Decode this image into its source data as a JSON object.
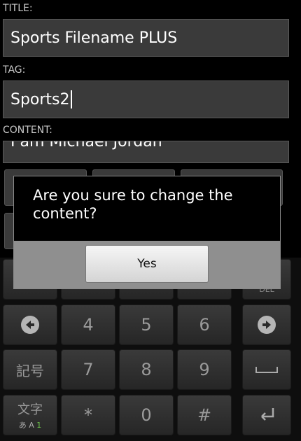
{
  "form": {
    "title_label": "TITLE:",
    "title_value": "Sports Filename PLUS",
    "tag_label": "TAG:",
    "tag_value": "Sports2",
    "content_label": "CONTENT:",
    "content_value": "I am Michael Jordan"
  },
  "dialog": {
    "message": "Are you sure to change the content?",
    "yes_label": "Yes"
  },
  "keyboard": {
    "row_digits_1": [
      "4",
      "5",
      "6"
    ],
    "row_digits_2": [
      "7",
      "8",
      "9"
    ],
    "row_bottom": [
      "*",
      "0",
      "#"
    ],
    "kigou_label": "記号",
    "moji_label": "文字",
    "mode_label": "あ A ",
    "mode_num": "1",
    "del_label": "DEL",
    "left_icon": "arrow-left-icon",
    "right_icon": "arrow-right-icon",
    "space_icon": "space-icon",
    "enter_icon": "enter-icon"
  }
}
